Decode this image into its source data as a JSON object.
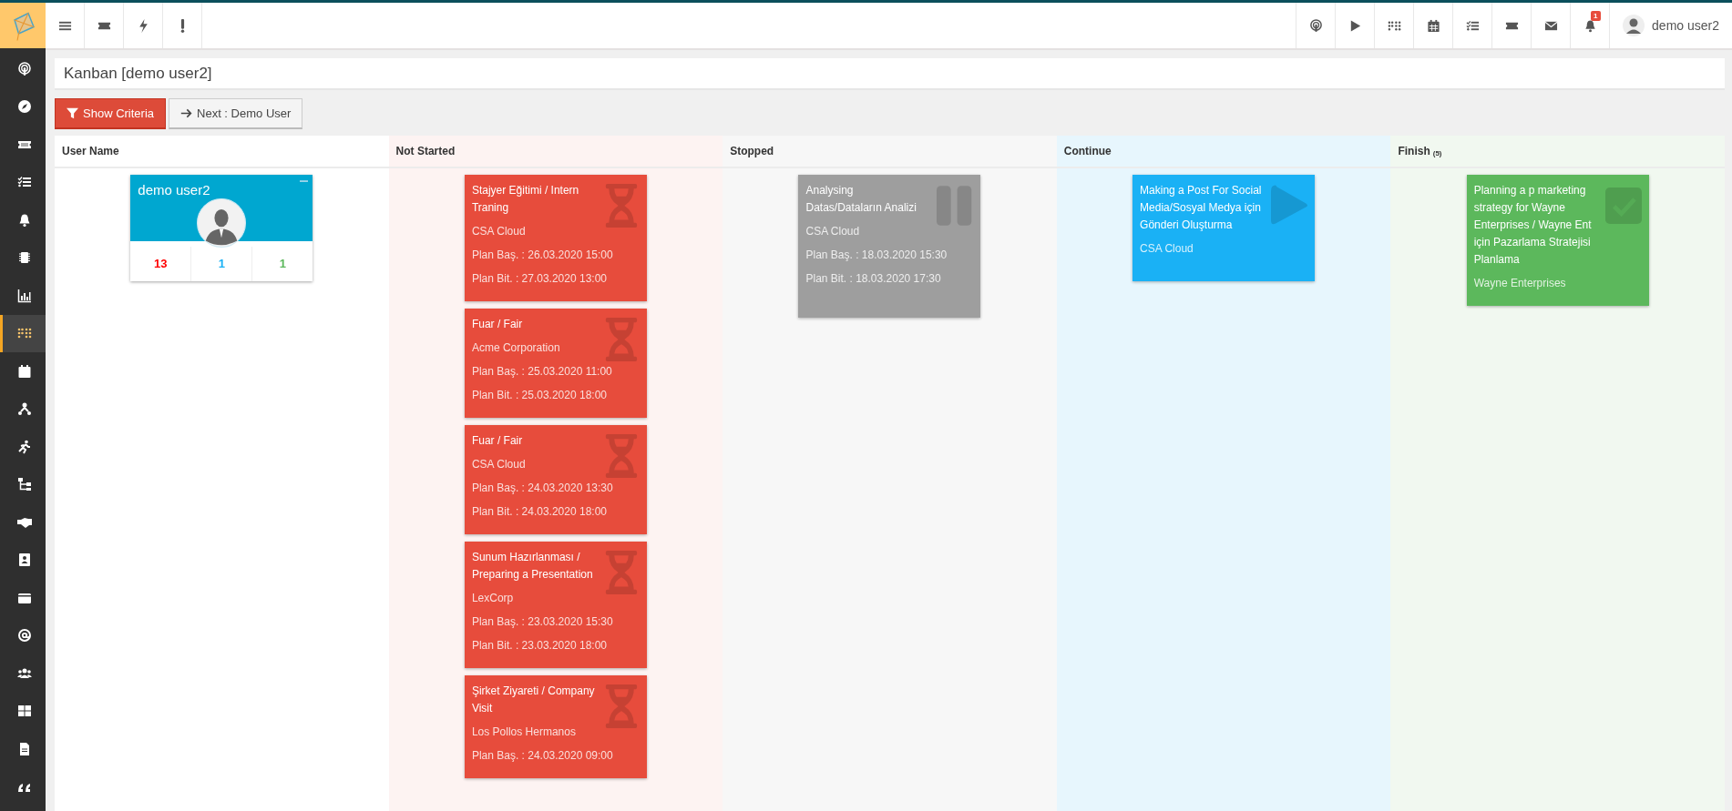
{
  "topbar": {
    "notification_badge": "1",
    "user_name": "demo user2"
  },
  "sidebar": {
    "items": [
      {
        "selected": false
      },
      {
        "selected": false
      },
      {
        "selected": false
      },
      {
        "selected": false
      },
      {
        "selected": false
      },
      {
        "selected": false
      },
      {
        "selected": false
      },
      {
        "selected": true
      },
      {
        "selected": false
      },
      {
        "selected": false
      },
      {
        "selected": false
      },
      {
        "selected": false
      },
      {
        "selected": false
      },
      {
        "selected": false
      },
      {
        "selected": false
      },
      {
        "selected": false
      },
      {
        "selected": false
      },
      {
        "selected": false
      },
      {
        "selected": false
      },
      {
        "selected": false
      }
    ]
  },
  "page": {
    "title": "Kanban [demo user2]"
  },
  "buttons": [
    {
      "label": "Show Criteria",
      "kind": "primary"
    },
    {
      "label": "Next : Demo User",
      "kind": "default"
    }
  ],
  "board": {
    "user_column": {
      "heading": "User Name",
      "user": {
        "name": "demo user2",
        "counts": [
          {
            "value": "13",
            "color": "#ff0000"
          },
          {
            "value": "1",
            "color": "#1ab1f5"
          },
          {
            "value": "1",
            "color": "#5cb85c"
          }
        ]
      }
    },
    "columns": [
      {
        "heading": "Not Started",
        "kind": "not_started",
        "cards": [
          {
            "title": "Stajyer Eğitimi / Intern Traning",
            "company": "CSA Cloud",
            "plan_start": "Plan Baş. : 26.03.2020 15:00",
            "plan_end": "Plan Bit. : 27.03.2020 13:00"
          },
          {
            "title": "Fuar / Fair",
            "company": "Acme Corporation",
            "plan_start": "Plan Baş. : 25.03.2020 11:00",
            "plan_end": "Plan Bit. : 25.03.2020 18:00"
          },
          {
            "title": "Fuar / Fair",
            "company": "CSA Cloud",
            "plan_start": "Plan Baş. : 24.03.2020 13:30",
            "plan_end": "Plan Bit. : 24.03.2020 18:00"
          },
          {
            "title": "Sunum Hazırlanması / Preparing a Presentation",
            "company": "LexCorp",
            "plan_start": "Plan Baş. : 23.03.2020 15:30",
            "plan_end": "Plan Bit. : 23.03.2020 18:00"
          },
          {
            "title": "Şirket Ziyareti / Company Visit",
            "company": "Los Pollos Hermanos",
            "plan_start": "Plan Baş. : 24.03.2020 09:00"
          }
        ]
      },
      {
        "heading": "Stopped",
        "kind": "stopped",
        "cards": [
          {
            "title": "Analysing Datas/Dataların Analizi",
            "company": "CSA Cloud",
            "plan_start": "Plan Baş. : 18.03.2020 15:30",
            "plan_end": "Plan Bit. : 18.03.2020 17:30"
          }
        ]
      },
      {
        "heading": "Continue",
        "kind": "continue",
        "cards": [
          {
            "title": "Making a Post For Social Media/Sosyal Medya için Gönderi Oluşturma",
            "company": "CSA Cloud"
          }
        ]
      },
      {
        "heading": "Finish",
        "count": "(5)",
        "kind": "finish",
        "cards": [
          {
            "title": "Planning a p marketing strategy for Wayne Enterprises / Wayne Ent için Pazarlama Stratejisi Planlama",
            "company": "Wayne Enterprises"
          }
        ]
      }
    ]
  }
}
